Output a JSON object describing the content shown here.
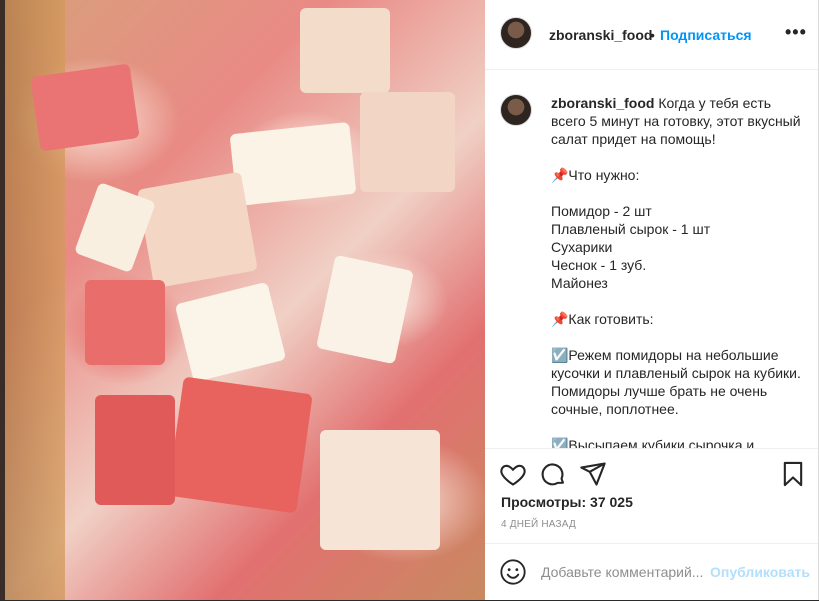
{
  "post": {
    "username": "zboranski_food",
    "dot": "•",
    "follow_label": "Подписаться",
    "more_label": "•••",
    "caption_lines": "Когда у тебя есть всего 5 минут на готовку, этот вкусный салат придет на помощь!\n\n📌Что нужно:\n\nПомидор - 2 шт\nПлавленый сырок - 1 шт\nСухарики\nЧеснок - 1 зуб.\nМайонез\n\n📌Как готовить:\n\n☑️Режем помидоры на небольшие кусочки и плавленый сырок на кубики. Помидоры лучше брать не очень сочные, поплотнее.\n\n☑️Высыпаем кубики сырочка и"
  },
  "stats": {
    "views": "Просмотры: 37 025",
    "age": "4 ДНЕЙ НАЗАД"
  },
  "comment": {
    "placeholder": "Добавьте комментарий...",
    "publish_label": "Опубликовать"
  },
  "icons": {
    "like": "heart-icon",
    "comment": "comment-icon",
    "share": "share-icon",
    "save": "bookmark-icon",
    "emoji": "emoji-icon"
  },
  "colors": {
    "link_blue": "#0095f6",
    "publish_disabled": "#b2dffc",
    "muted": "#8e8e8e"
  }
}
